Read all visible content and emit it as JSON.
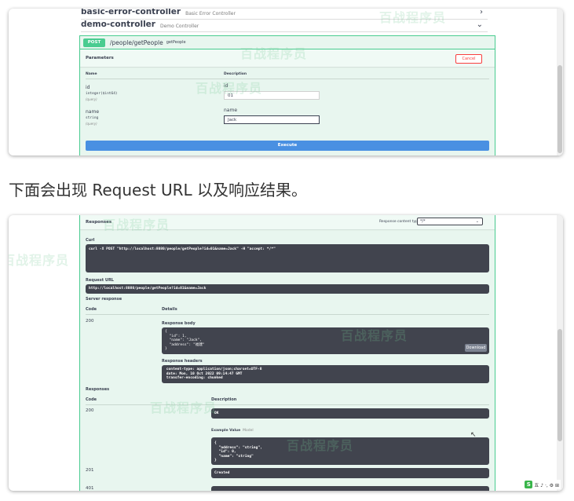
{
  "shot1": {
    "tags": [
      {
        "name": "basic-error-controller",
        "description": "Basic Error Controller"
      },
      {
        "name": "demo-controller",
        "description": "Demo Controller"
      }
    ],
    "operation": {
      "method": "POST",
      "path": "/people/getPeople",
      "summary": "getPeople"
    },
    "parameters_title": "Parameters",
    "cancel_label": "Cancel",
    "col_name": "Name",
    "col_description": "Description",
    "params": [
      {
        "name": "id",
        "type": "integer($int64)",
        "in": "(query)",
        "label": "id",
        "value": "01"
      },
      {
        "name": "name",
        "type": "string",
        "in": "(query)",
        "label": "name",
        "value": "Jack"
      }
    ],
    "execute_label": "Execute",
    "watermark": "百战程序员"
  },
  "caption": "下面会出现 Request URL 以及响应结果。",
  "shot2": {
    "responses_title": "Responses",
    "content_type_label": "Response content type",
    "content_type_value": "*/*",
    "curl_title": "Curl",
    "curl_command": "curl -X POST \"http://localhost:8080/people/getPeople?id=01&name=Jack\" -H \"accept: */*\"",
    "request_url_title": "Request URL",
    "request_url": "http://localhost:8080/people/getPeople?id=01&name=Jack",
    "server_response_title": "Server response",
    "col_code": "Code",
    "col_details": "Details",
    "response_code": "200",
    "response_body_title": "Response body",
    "response_body": "{\n  \"id\": 1,\n  \"name\": \"Jack\",\n  \"address\": \"福建\"\n}",
    "download_label": "Download",
    "response_headers_title": "Response headers",
    "response_headers": " content-type: application/json;charset=UTF-8\n date: Mon, 10 Oct 2022 09:14:47 GMT\n transfer-encoding: chunked",
    "responses2_title": "Responses",
    "col_code2": "Code",
    "col_description2": "Description",
    "doc_responses": [
      {
        "code": "200",
        "description": "OK"
      },
      {
        "code": "201",
        "description": "Created"
      },
      {
        "code": "401",
        "description": ""
      }
    ],
    "example_tab": "Example Value",
    "model_tab": "Model",
    "example_value": "{\n  \"address\": \"string\",\n  \"id\": 0,\n  \"name\": \"string\"\n}",
    "watermark": "百战程序员",
    "tray_text": "五 ♪ ·, ⚙ ⊞"
  }
}
